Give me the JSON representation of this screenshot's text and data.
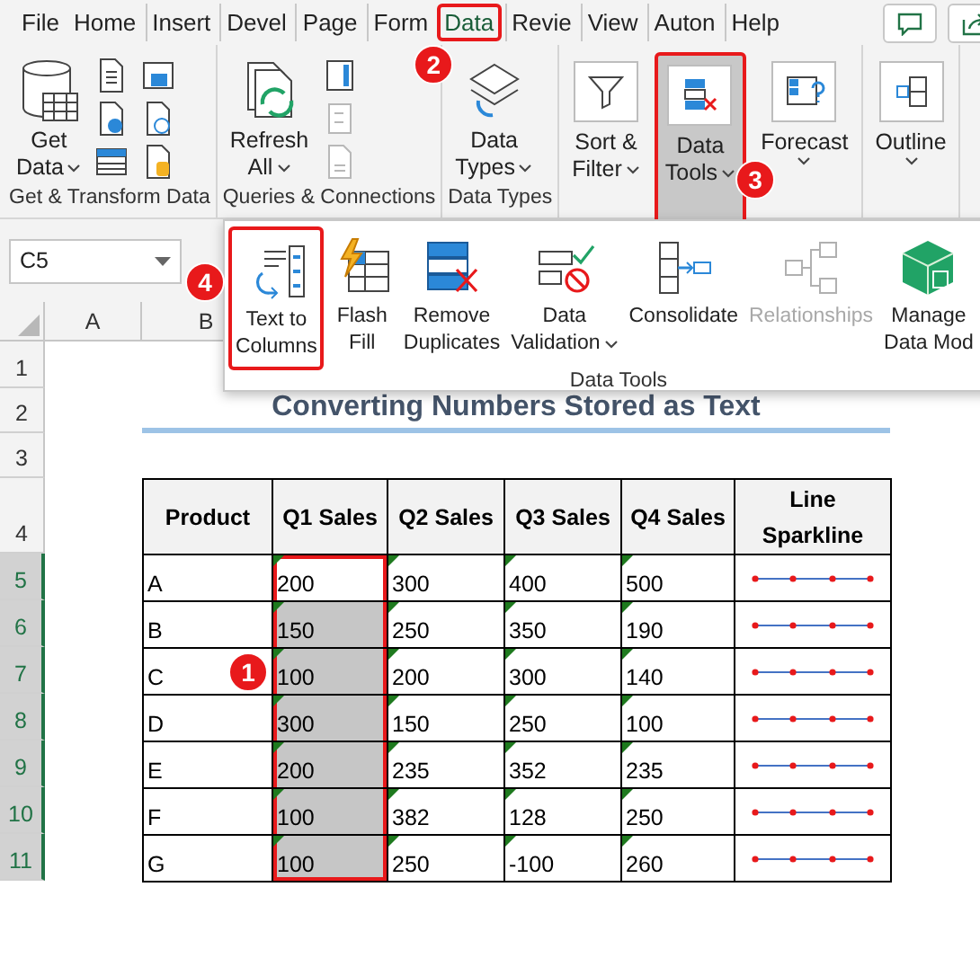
{
  "menu_tabs": [
    {
      "label": "File",
      "selected": false,
      "highlighted": false
    },
    {
      "label": "Home",
      "selected": false,
      "highlighted": false
    },
    {
      "label": "Insert",
      "selected": false,
      "highlighted": false
    },
    {
      "label": "Devel",
      "selected": false,
      "highlighted": false
    },
    {
      "label": "Page",
      "selected": false,
      "highlighted": false
    },
    {
      "label": "Form",
      "selected": false,
      "highlighted": false
    },
    {
      "label": "Data",
      "selected": true,
      "highlighted": true,
      "badge": "2"
    },
    {
      "label": "Revie",
      "selected": false,
      "highlighted": false
    },
    {
      "label": "View",
      "selected": false,
      "highlighted": false
    },
    {
      "label": "Auton",
      "selected": false,
      "highlighted": false
    },
    {
      "label": "Help",
      "selected": false,
      "highlighted": false
    }
  ],
  "ribbon": {
    "groups": [
      {
        "label": "Get & Transform Data",
        "buttons": [
          {
            "lines": [
              "Get",
              "Data"
            ],
            "dropdown": true,
            "pressed": false,
            "highlighted": false
          }
        ]
      },
      {
        "label": "Queries & Connections",
        "buttons": [
          {
            "lines": [
              "Refresh",
              "All"
            ],
            "dropdown": true,
            "pressed": false,
            "highlighted": false
          }
        ]
      },
      {
        "label": "Data Types",
        "buttons": [
          {
            "lines": [
              "Data",
              "Types"
            ],
            "dropdown": true,
            "pressed": false,
            "highlighted": false
          }
        ]
      },
      {
        "buttons": [
          {
            "lines": [
              "Sort &",
              "Filter"
            ],
            "dropdown": true,
            "pressed": false,
            "highlighted": false
          },
          {
            "lines": [
              "Data",
              "Tools"
            ],
            "dropdown": true,
            "pressed": true,
            "highlighted": true,
            "badge": "3"
          },
          {
            "lines": [
              "Forecast"
            ],
            "dropdown": true,
            "pressed": false,
            "highlighted": false
          }
        ]
      },
      {
        "buttons": [
          {
            "lines": [
              "Outline"
            ],
            "dropdown": true,
            "pressed": false,
            "highlighted": false
          }
        ]
      }
    ]
  },
  "data_tools_menu": {
    "label": "Data Tools",
    "buttons": [
      {
        "lines": [
          "Text to",
          "Columns"
        ],
        "highlighted": true,
        "badge": "4",
        "disabled": false
      },
      {
        "lines": [
          "Flash",
          "Fill"
        ],
        "highlighted": false,
        "disabled": false
      },
      {
        "lines": [
          "Remove",
          "Duplicates"
        ],
        "highlighted": false,
        "disabled": false
      },
      {
        "lines": [
          "Data",
          "Validation"
        ],
        "dropdown": true,
        "highlighted": false,
        "disabled": false
      },
      {
        "lines": [
          "Consolidate"
        ],
        "highlighted": false,
        "disabled": false
      },
      {
        "lines": [
          "Relationships"
        ],
        "highlighted": false,
        "disabled": true
      },
      {
        "lines": [
          "Manage",
          "Data Mod"
        ],
        "highlighted": false,
        "disabled": false
      }
    ]
  },
  "name_box": {
    "value": "C5"
  },
  "column_headers": [
    "A",
    "B"
  ],
  "row_headers": [
    {
      "label": "1",
      "selected": false
    },
    {
      "label": "2",
      "selected": false
    },
    {
      "label": "3",
      "selected": false
    },
    {
      "label": "4",
      "selected": false
    },
    {
      "label": "5",
      "selected": true
    },
    {
      "label": "6",
      "selected": true
    },
    {
      "label": "7",
      "selected": true
    },
    {
      "label": "8",
      "selected": true
    },
    {
      "label": "9",
      "selected": true
    },
    {
      "label": "10",
      "selected": true
    },
    {
      "label": "11",
      "selected": true
    }
  ],
  "sheet": {
    "title": "Converting Numbers Stored as Text",
    "table": {
      "columns": [
        "Product",
        "Q1 Sales",
        "Q2 Sales",
        "Q3 Sales",
        "Q4 Sales",
        "Line Sparkline"
      ],
      "rows": [
        {
          "cells": [
            {
              "text": "A"
            },
            {
              "text": "200",
              "shaded": false,
              "outlined": true
            },
            {
              "text": "300",
              "shaded": false,
              "outlined": false
            },
            {
              "text": "400",
              "shaded": false,
              "outlined": false
            },
            {
              "text": "500",
              "shaded": false,
              "outlined": false
            }
          ]
        },
        {
          "cells": [
            {
              "text": "B"
            },
            {
              "text": "150",
              "shaded": true,
              "outlined": true
            },
            {
              "text": "250",
              "shaded": false,
              "outlined": false
            },
            {
              "text": "350",
              "shaded": false,
              "outlined": false
            },
            {
              "text": "190",
              "shaded": false,
              "outlined": false
            }
          ]
        },
        {
          "badge": "1",
          "cells": [
            {
              "text": "C"
            },
            {
              "text": "100",
              "shaded": true,
              "outlined": true
            },
            {
              "text": "200",
              "shaded": false,
              "outlined": false
            },
            {
              "text": "300",
              "shaded": false,
              "outlined": false
            },
            {
              "text": "140",
              "shaded": false,
              "outlined": false
            }
          ]
        },
        {
          "cells": [
            {
              "text": "D"
            },
            {
              "text": "300",
              "shaded": true,
              "outlined": true
            },
            {
              "text": "150",
              "shaded": false,
              "outlined": false
            },
            {
              "text": "250",
              "shaded": false,
              "outlined": false
            },
            {
              "text": "100",
              "shaded": false,
              "outlined": false
            }
          ]
        },
        {
          "cells": [
            {
              "text": "E"
            },
            {
              "text": "200",
              "shaded": true,
              "outlined": true
            },
            {
              "text": "235",
              "shaded": false,
              "outlined": false
            },
            {
              "text": "352",
              "shaded": false,
              "outlined": false
            },
            {
              "text": "235",
              "shaded": false,
              "outlined": false
            }
          ]
        },
        {
          "cells": [
            {
              "text": "F"
            },
            {
              "text": "100",
              "shaded": true,
              "outlined": true
            },
            {
              "text": "382",
              "shaded": false,
              "outlined": false
            },
            {
              "text": "128",
              "shaded": false,
              "outlined": false
            },
            {
              "text": "250",
              "shaded": false,
              "outlined": false
            }
          ]
        },
        {
          "cells": [
            {
              "text": "G"
            },
            {
              "text": "100",
              "shaded": true,
              "outlined": true
            },
            {
              "text": "250",
              "shaded": false,
              "outlined": false
            },
            {
              "text": "-100",
              "shaded": false,
              "outlined": false
            },
            {
              "text": "260",
              "shaded": false,
              "outlined": false
            }
          ]
        }
      ]
    }
  }
}
